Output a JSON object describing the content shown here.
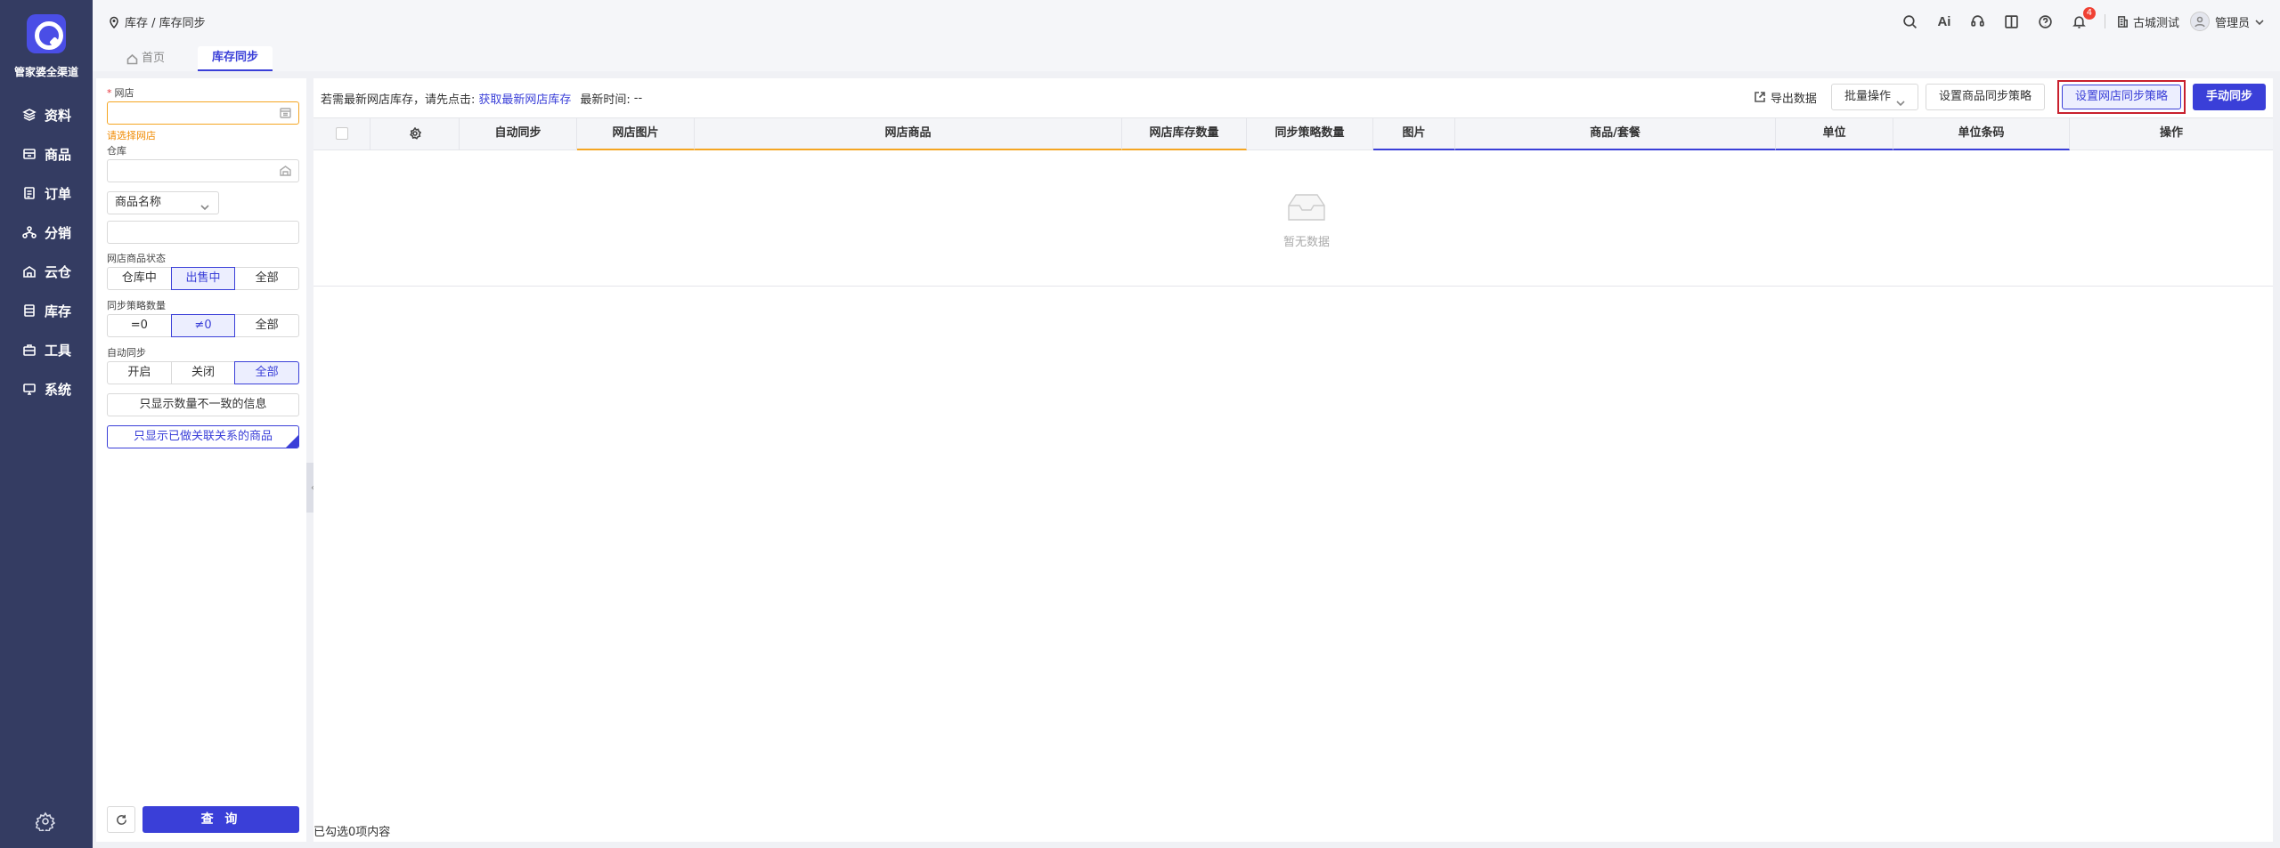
{
  "sidebar": {
    "brand": "管家婆全渠道",
    "items": [
      {
        "label": "资料",
        "icon": "layers-icon"
      },
      {
        "label": "商品",
        "icon": "box-icon"
      },
      {
        "label": "订单",
        "icon": "document-icon"
      },
      {
        "label": "分销",
        "icon": "network-icon"
      },
      {
        "label": "云仓",
        "icon": "cloud-warehouse-icon"
      },
      {
        "label": "库存",
        "icon": "stack-icon"
      },
      {
        "label": "工具",
        "icon": "toolbox-icon"
      },
      {
        "label": "系统",
        "icon": "monitor-icon"
      }
    ]
  },
  "header": {
    "breadcrumb": "库存 / 库存同步",
    "ai_label": "Ai",
    "notification_count": "4",
    "company": "古城测试",
    "user": "管理员"
  },
  "tabs": [
    {
      "label": "首页"
    },
    {
      "label": "库存同步"
    }
  ],
  "filter": {
    "shop_label": "网店",
    "shop_value": "",
    "shop_error": "请选择网店",
    "warehouse_label": "仓库",
    "warehouse_value": "",
    "search_field_select": "商品名称",
    "search_value": "",
    "status_label": "网店商品状态",
    "status_options": [
      "仓库中",
      "出售中",
      "全部"
    ],
    "strategy_label": "同步策略数量",
    "strategy_options": [
      "=0",
      "≠0",
      "全部"
    ],
    "auto_sync_label": "自动同步",
    "auto_sync_options": [
      "开启",
      "关闭",
      "全部"
    ],
    "only_mismatch": "只显示数量不一致的信息",
    "only_linked": "只显示已做关联关系的商品",
    "query": "查 询"
  },
  "main": {
    "info_prefix": "若需最新网店库存，请先点击:",
    "info_link": "获取最新网店库存",
    "info_time_label": "最新时间:",
    "info_time_value": "--",
    "export": "导出数据",
    "batch": "批量操作",
    "set_product_strategy": "设置商品同步策略",
    "set_shop_strategy": "设置网店同步策略",
    "manual_sync": "手动同步",
    "columns": [
      "自动同步",
      "网店图片",
      "网店商品",
      "网店库存数量",
      "同步策略数量",
      "图片",
      "商品/套餐",
      "单位",
      "单位条码",
      "操作"
    ],
    "empty_text": "暂无数据",
    "selected_count": "已勾选0项内容"
  },
  "colors": {
    "sidebar_bg": "#343c62",
    "primary": "#3a3fd8",
    "warning": "#f5a623",
    "highlight": "#c8202d"
  }
}
